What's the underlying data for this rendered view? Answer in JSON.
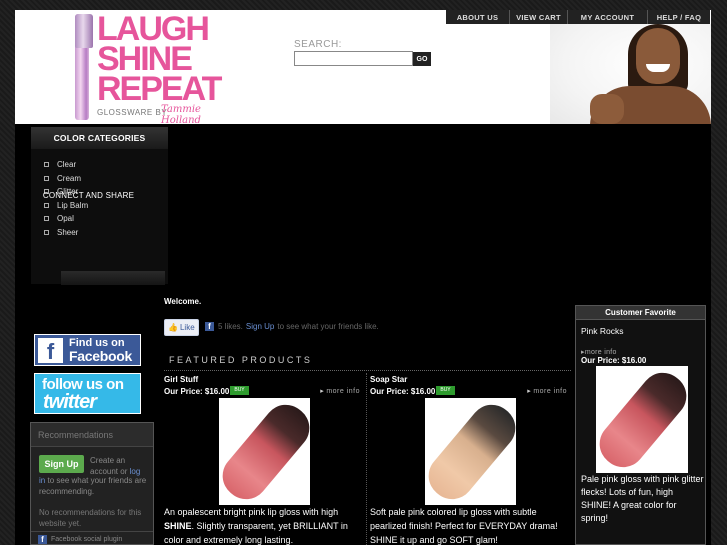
{
  "header": {
    "logo": {
      "line1": "LAUGH",
      "line2": "SHINE",
      "line3": "REPEAT",
      "subtitle": "GLOSSWARE BY",
      "signature": "Tammie Holland"
    },
    "search": {
      "label": "SEARCH:",
      "placeholder": "",
      "go_label": "GO"
    },
    "nav": [
      {
        "label": "ABOUT US"
      },
      {
        "label": "VIEW CART"
      },
      {
        "label": "MY ACCOUNT"
      },
      {
        "label": "HELP / FAQ"
      }
    ]
  },
  "sidebar": {
    "categories_title": "COLOR CATEGORIES",
    "categories": [
      {
        "label": "Clear"
      },
      {
        "label": "Cream"
      },
      {
        "label": "Glitter"
      },
      {
        "label": "Lip Balm"
      },
      {
        "label": "Opal"
      },
      {
        "label": "Sheer"
      }
    ],
    "connect_label": "CONNECT AND SHARE",
    "facebook_badge": {
      "line1": "Find us on",
      "line2": "Facebook"
    },
    "twitter_badge": {
      "line1": "follow us on",
      "line2": "twitter"
    },
    "recommendations": {
      "title": "Recommendations",
      "signup_label": "Sign Up",
      "text_a": "Create an account or",
      "text_log": "log",
      "text_in": "in",
      "text_b": "to see what your friends are recommending.",
      "empty_text": "No recommendations for this website yet.",
      "plugin_label": "Facebook social plugin"
    }
  },
  "main": {
    "welcome": "Welcome.",
    "like": {
      "button_label": "Like",
      "count_text": "5 likes.",
      "signup_label": "Sign Up",
      "suffix_text": "to see what your friends like."
    },
    "featured_title": "FEATURED PRODUCTS",
    "products": [
      {
        "name": "Girl Stuff",
        "price": "Our Price: $16.00",
        "buy_label": "BUY",
        "more_label": "more info",
        "desc_pre": "An opalescent bright pink lip gloss with high ",
        "desc_bold": "SHINE",
        "desc_post": ".  Slightly transparent, yet BRILLIANT in color and extremely long lasting."
      },
      {
        "name": "Soap Star",
        "price": "Our Price: $16.00",
        "buy_label": "BUY",
        "more_label": "more info",
        "desc_pre": "Soft pale pink colored lip gloss with subtle pearlized finish! Perfect for EVERYDAY drama! SHINE it up and go SOFT glam!",
        "desc_bold": "",
        "desc_post": ""
      }
    ]
  },
  "favorite": {
    "title": "Customer Favorite",
    "name": "Pink Rocks",
    "more_label": "more info",
    "price": "Our Price: $16.00",
    "desc": "Pale pink gloss with pink glitter flecks! Lots of fun, high SHINE! A great color for spring!"
  }
}
